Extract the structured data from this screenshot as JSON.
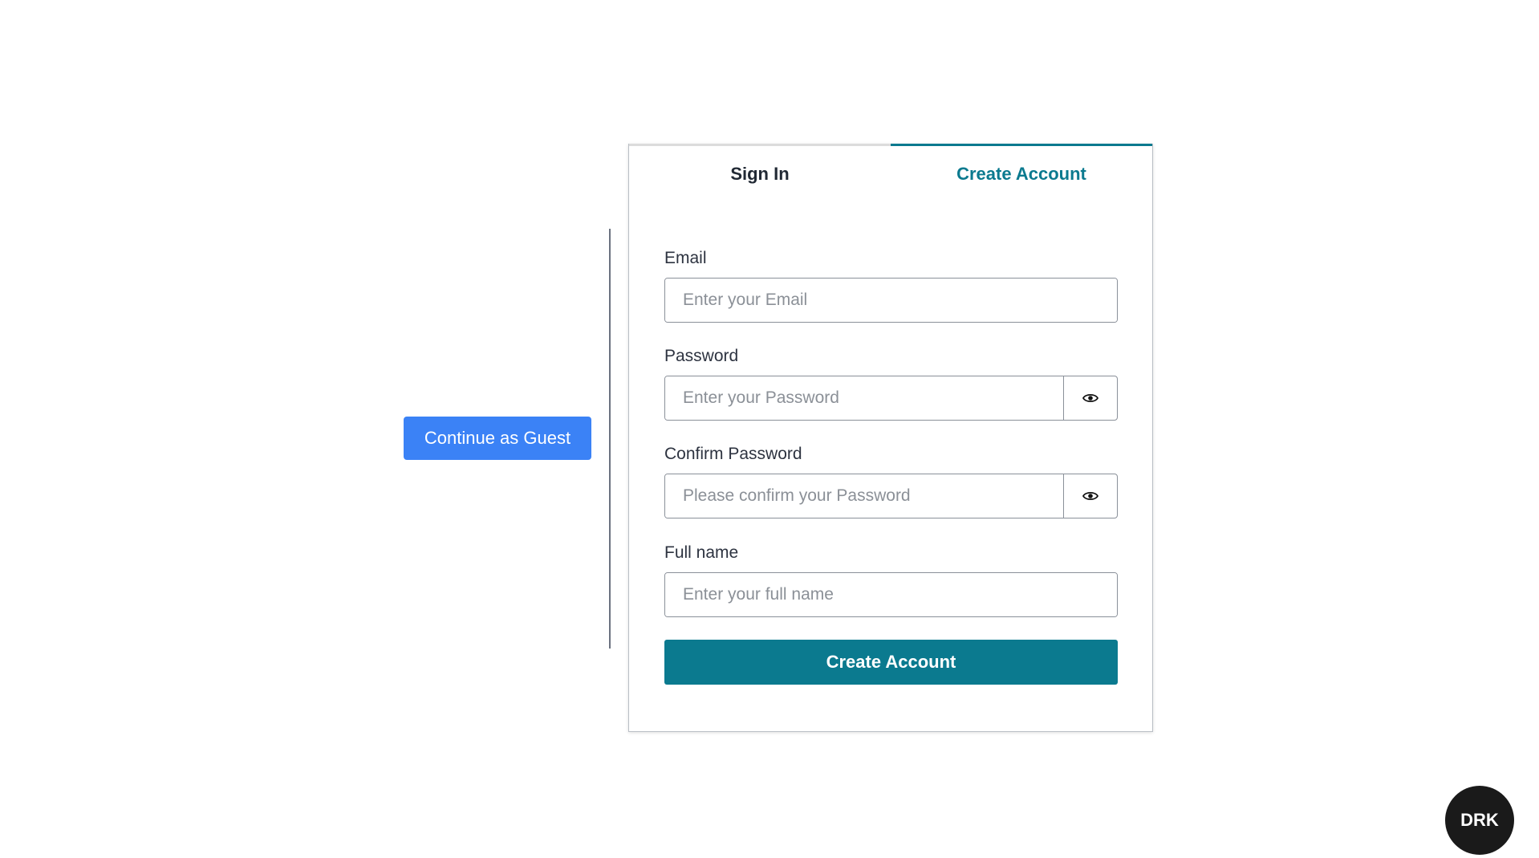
{
  "guest_button": "Continue as Guest",
  "tabs": [
    {
      "label": "Sign In",
      "active": false
    },
    {
      "label": "Create Account",
      "active": true
    }
  ],
  "form": {
    "email": {
      "label": "Email",
      "placeholder": "Enter your Email",
      "value": ""
    },
    "password": {
      "label": "Password",
      "placeholder": "Enter your Password",
      "value": "",
      "icon": "eye-icon"
    },
    "confirm_password": {
      "label": "Confirm Password",
      "placeholder": "Please confirm your Password",
      "value": "",
      "icon": "eye-icon"
    },
    "full_name": {
      "label": "Full name",
      "placeholder": "Enter your full name",
      "value": ""
    },
    "submit": "Create Account"
  },
  "theme_toggle": "DRK",
  "colors": {
    "accent": "#0b7a8f",
    "guest": "#3b82f6",
    "toggle": "#1a1a1a"
  }
}
